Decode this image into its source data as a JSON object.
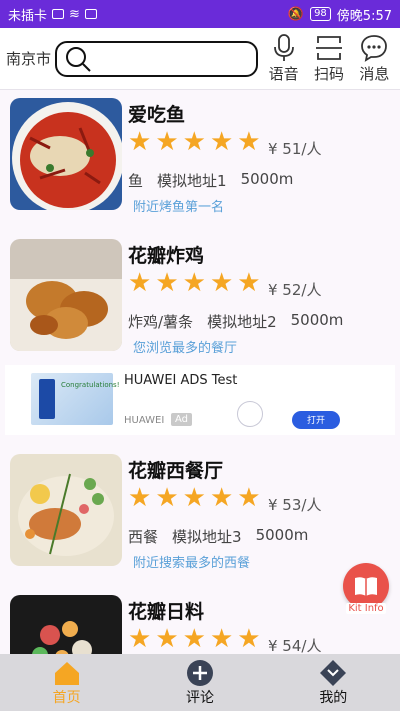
{
  "statusbar": {
    "carrier": "未插卡",
    "battery": "98",
    "time": "傍晚5:57"
  },
  "topbar": {
    "city": "南京市",
    "search_placeholder": "",
    "voice_label": "语音",
    "scan_label": "扫码",
    "message_label": "消息"
  },
  "restaurants": [
    {
      "name": "爱吃鱼",
      "rating": 5,
      "price": "¥ 51/人",
      "category": "鱼",
      "address": "模拟地址1",
      "distance": "5000m",
      "tag": "附近烤鱼第一名"
    },
    {
      "name": "花瓣炸鸡",
      "rating": 5,
      "price": "¥ 52/人",
      "category": "炸鸡/薯条",
      "address": "模拟地址2",
      "distance": "5000m",
      "tag": "您浏览最多的餐厅"
    },
    {
      "name": "花瓣西餐厅",
      "rating": 5,
      "price": "¥ 53/人",
      "category": "西餐",
      "address": "模拟地址3",
      "distance": "5000m",
      "tag": "附近搜索最多的西餐"
    },
    {
      "name": "花瓣日料",
      "rating": 5,
      "price": "¥ 54/人",
      "category": "",
      "address": "",
      "distance": "",
      "tag": ""
    }
  ],
  "ad": {
    "title": "HUAWEI ADS Test",
    "brand": "HUAWEI",
    "badge": "Ad",
    "open_label": "打开",
    "image_text": "Congratulations!"
  },
  "kit": {
    "label": "Kit Info"
  },
  "nav": [
    {
      "label": "首页",
      "icon": "home-icon",
      "active": true
    },
    {
      "label": "评论",
      "icon": "plus-circle-icon",
      "active": false
    },
    {
      "label": "我的",
      "icon": "heart-badge-icon",
      "active": false
    }
  ],
  "colors": {
    "accent": "#f5a623",
    "status_bar": "#6a2bd9",
    "tag_blue": "#5aa0d8",
    "kit_red": "#e9524a"
  }
}
